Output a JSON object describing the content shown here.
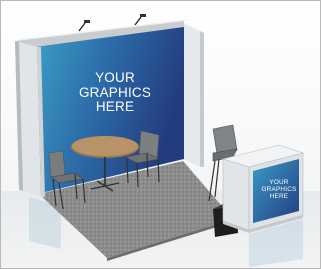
{
  "booth_graphic": {
    "back_wall": {
      "lines": [
        "YOUR",
        "GRAPHICS",
        "HERE"
      ]
    },
    "counter": {
      "lines": [
        "YOUR",
        "GRAPHICS",
        "HERE"
      ]
    }
  },
  "colors": {
    "graphic_dark": "#1c3a78",
    "graphic_light": "#3fa6c9",
    "carpet": "#8e8e8e",
    "frame": "#d9dcde"
  }
}
